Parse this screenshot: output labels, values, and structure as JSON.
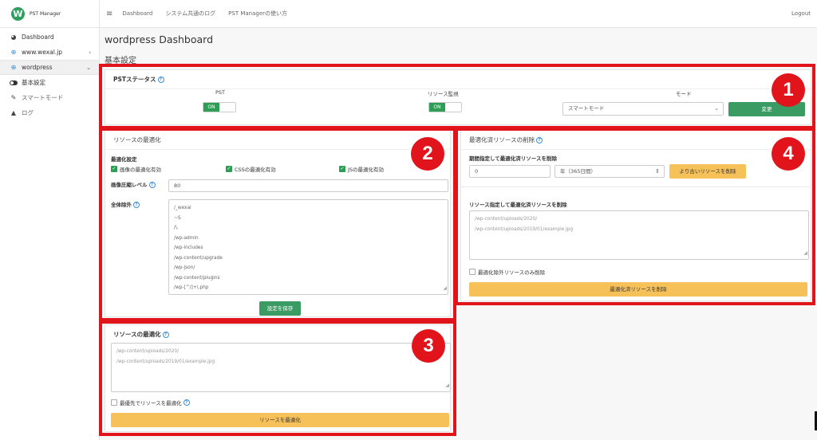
{
  "sidebar": {
    "brand": "PST Manager",
    "brand_initial": "W",
    "items": [
      {
        "label": "Dashboard",
        "icon": "dashboard-icon"
      },
      {
        "label": "www.wexal.jp",
        "icon": "globe-icon",
        "chevron": "‹"
      },
      {
        "label": "wordpress",
        "icon": "globe-icon",
        "chevron": "⌄"
      },
      {
        "label": "基本設定",
        "icon": "toggle-icon"
      },
      {
        "label": "スマートモード",
        "icon": "wrench-icon"
      },
      {
        "label": "ログ",
        "icon": "warning-icon"
      }
    ]
  },
  "topbar": {
    "links": [
      "Dashboard",
      "システム共通のログ",
      "PST Managerの使い方"
    ],
    "logout": "Logout"
  },
  "page": {
    "title": "wordpress Dashboard",
    "section": "基本設定"
  },
  "pst_status": {
    "title": "PSTステータス",
    "pst_label": "PST",
    "pst_state": "ON",
    "resource_label": "リソース監視",
    "resource_state": "ON",
    "mode_label": "モード",
    "mode_value": "スマートモード",
    "change_button": "変更"
  },
  "optimize": {
    "title": "リソースの最適化",
    "settings_label": "最適化設定",
    "image_opt": "画像の最適化有効",
    "css_opt": "CSSの最適化有効",
    "js_opt": "JSの最適化有効",
    "compress_label": "画像圧縮レベル",
    "compress_value": "80",
    "exclude_label": "全体除外",
    "exclude_lines": [
      "/_wexal",
      "~S",
      "/\\.",
      "/wp-admin",
      "/wp-includes",
      "/wp-content/upgrade",
      "/wp-json/",
      "/wp-content/plugins",
      "/wp-[^/]+\\.php"
    ],
    "save_button": "設定を保存"
  },
  "resource_opt": {
    "title": "リソースの最適化",
    "placeholder_lines": [
      "/wp-content/uploads/2020/",
      "/wp-content/uploads/2019/01/example.jpg"
    ],
    "priority_label": "最優先でリソースを最適化",
    "button": "リソースを最適化"
  },
  "delete": {
    "title": "最適化済リソースの削除",
    "period_label": "期間指定して最適化済リソースを削除",
    "period_value": "0",
    "period_select": "年（365日間）",
    "older_button": "より古いリソースを削除",
    "resource_label": "リソース指定して最適化済リソースを削除",
    "placeholder_lines": [
      "/wp-content/uploads/2020/",
      "/wp-content/uploads/2019/01/example.jpg"
    ],
    "excluded_only": "最適化除外リソースのみ削除",
    "delete_button": "最適化済リソースを削除"
  },
  "badges": [
    "1",
    "2",
    "3",
    "4"
  ]
}
